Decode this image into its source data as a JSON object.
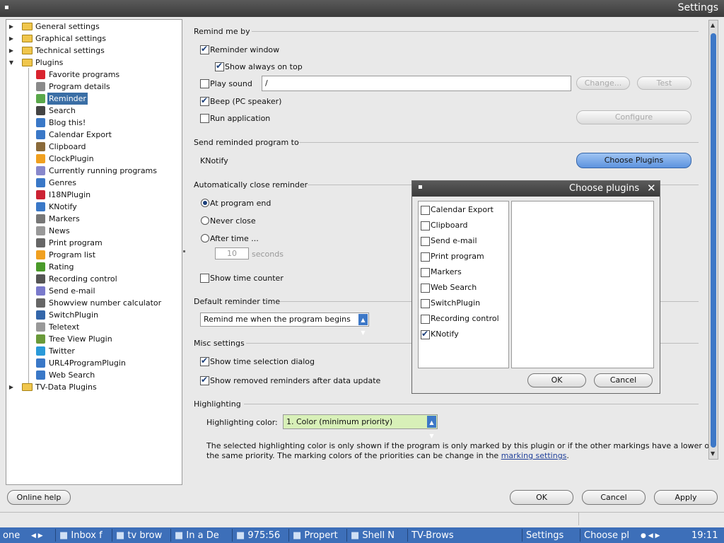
{
  "window": {
    "title": "Settings"
  },
  "tree": {
    "items": [
      {
        "label": "General settings"
      },
      {
        "label": "Graphical settings"
      },
      {
        "label": "Technical settings"
      },
      {
        "label": "Plugins"
      },
      {
        "label": "Favorite programs"
      },
      {
        "label": "Program details"
      },
      {
        "label": "Reminder"
      },
      {
        "label": "Search"
      },
      {
        "label": "Blog this!"
      },
      {
        "label": "Calendar Export"
      },
      {
        "label": "Clipboard"
      },
      {
        "label": "ClockPlugin"
      },
      {
        "label": "Currently running programs"
      },
      {
        "label": "Genres"
      },
      {
        "label": "I18NPlugin"
      },
      {
        "label": "KNotify"
      },
      {
        "label": "Markers"
      },
      {
        "label": "News"
      },
      {
        "label": "Print program"
      },
      {
        "label": "Program list"
      },
      {
        "label": "Rating"
      },
      {
        "label": "Recording control"
      },
      {
        "label": "Send e-mail"
      },
      {
        "label": "Showview number calculator"
      },
      {
        "label": "SwitchPlugin"
      },
      {
        "label": "Teletext"
      },
      {
        "label": "Tree View Plugin"
      },
      {
        "label": "Twitter"
      },
      {
        "label": "URL4ProgramPlugin"
      },
      {
        "label": "Web Search"
      },
      {
        "label": "TV-Data Plugins"
      }
    ],
    "selected": "Reminder"
  },
  "remind": {
    "header": "Remind me by",
    "reminder_window": "Reminder window",
    "show_on_top": "Show always on top",
    "play_sound": "Play sound",
    "sound_path": "/",
    "change": "Change...",
    "test": "Test",
    "beep": "Beep (PC speaker)",
    "run_app": "Run application",
    "configure": "Configure"
  },
  "send": {
    "header": "Send reminded program to",
    "target": "KNotify",
    "choose": "Choose Plugins"
  },
  "autoclose": {
    "header": "Automatically close reminder",
    "at_end": "At program end",
    "never": "Never close",
    "after_time": "After time ...",
    "value": "10",
    "unit": "seconds",
    "show_counter": "Show time counter"
  },
  "default_time": {
    "header": "Default reminder time",
    "value": "Remind me when the program begins"
  },
  "misc": {
    "header": "Misc settings",
    "show_selection": "Show time selection dialog",
    "show_removed": "Show removed reminders after data update"
  },
  "highlight": {
    "header": "Highlighting",
    "label": "Highlighting color:",
    "value": "1. Color (minimum priority)",
    "note1": "The selected highlighting color is only shown if the program is only marked by this plugin or if the other markings have a lower or",
    "note2": "the same priority. The marking colors of the priorities can be change in the",
    "link": "marking settings",
    "period": "."
  },
  "dialog": {
    "title": "Choose plugins",
    "items": [
      {
        "label": "Calendar Export",
        "checked": false
      },
      {
        "label": "Clipboard",
        "checked": false
      },
      {
        "label": "Send e-mail",
        "checked": false
      },
      {
        "label": "Print program",
        "checked": false
      },
      {
        "label": "Markers",
        "checked": false
      },
      {
        "label": "Web Search",
        "checked": false
      },
      {
        "label": "SwitchPlugin",
        "checked": false
      },
      {
        "label": "Recording control",
        "checked": false
      },
      {
        "label": "KNotify",
        "checked": true
      }
    ],
    "ok": "OK",
    "cancel": "Cancel"
  },
  "bottom": {
    "help": "Online help",
    "ok": "OK",
    "cancel": "Cancel",
    "apply": "Apply"
  },
  "taskbar": {
    "items": [
      "one",
      "Inbox f",
      "tv brow",
      "In a De",
      "975:56",
      "Propert",
      "Shell N",
      "TV-Brows",
      "Settings",
      "Choose pl"
    ],
    "clock": "19:11"
  },
  "colors": {
    "accent": "#3d78c7",
    "selection": "#3a6ea5",
    "taskbar": "#3d6fb9",
    "highlight_value": "#d8f0b8"
  }
}
